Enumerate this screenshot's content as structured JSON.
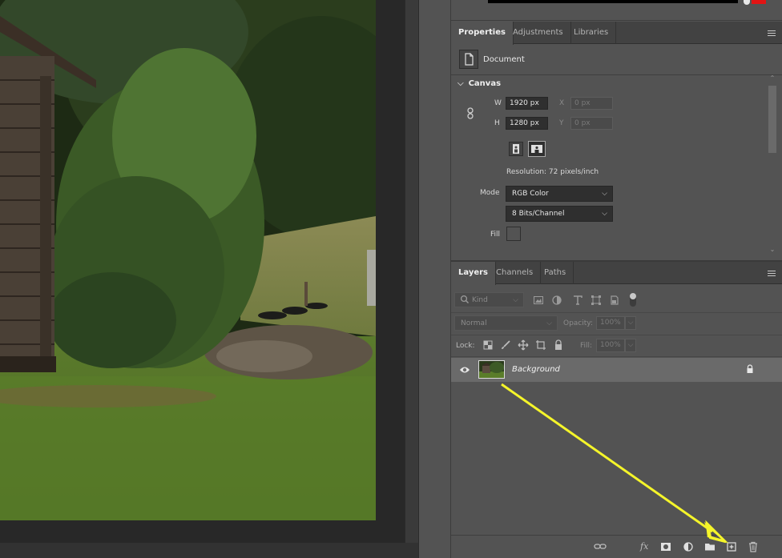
{
  "properties_tabs": [
    {
      "label": "Properties",
      "active": true
    },
    {
      "label": "Adjustments",
      "active": false
    },
    {
      "label": "Libraries",
      "active": false
    }
  ],
  "properties": {
    "doc_label": "Document",
    "canvas_header": "Canvas",
    "w_label": "W",
    "w_value": "1920 px",
    "h_label": "H",
    "h_value": "1280 px",
    "x_label": "X",
    "x_value": "0 px",
    "y_label": "Y",
    "y_value": "0 px",
    "resolution": "Resolution: 72 pixels/inch",
    "mode_label": "Mode",
    "mode_value": "RGB Color",
    "bits_value": "8 Bits/Channel",
    "fill_label": "Fill"
  },
  "layers_tabs": [
    {
      "label": "Layers",
      "active": true
    },
    {
      "label": "Channels",
      "active": false
    },
    {
      "label": "Paths",
      "active": false
    }
  ],
  "layers": {
    "filter_kind": "Kind",
    "blend_mode": "Normal",
    "opacity_label": "Opacity:",
    "opacity_value": "100%",
    "lock_label": "Lock:",
    "fill_label": "Fill:",
    "fill_value": "100%",
    "layer_name": "Background"
  },
  "colors": {
    "panel_bg": "#535353",
    "tab_bar_bg": "#424242",
    "layer_selected_bg": "#6a6a6a",
    "arrow_annotation": "#f5f52a",
    "swatch_red": "#e11414"
  },
  "icons": {
    "footer": [
      "link-layers-icon",
      "fx-icon",
      "mask-icon",
      "adjustment-layer-icon",
      "group-folder-icon",
      "new-layer-icon",
      "trash-icon"
    ]
  }
}
